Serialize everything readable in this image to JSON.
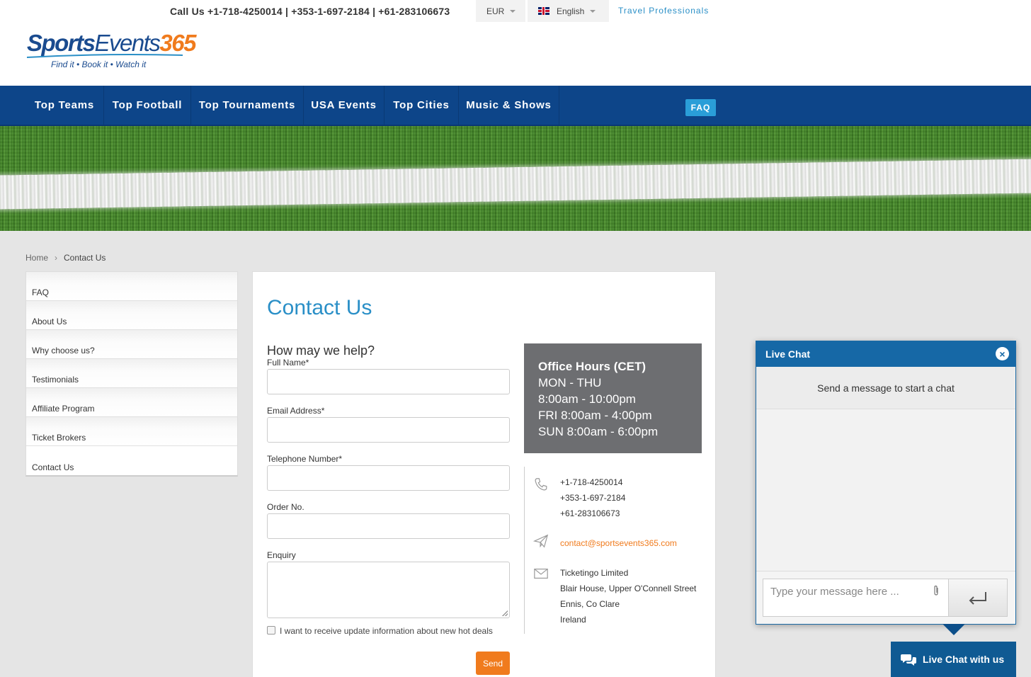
{
  "header": {
    "call_us": "Call Us +1-718-4250014 | +353-1-697-2184 | +61-283106673",
    "currency": "EUR",
    "language": "English",
    "travel_professionals": "Travel Professionals",
    "logo": {
      "brand_part1": "Sports",
      "brand_part2": "Events",
      "brand_part3": "365",
      "tagline": "Find it • Book it • Watch it"
    }
  },
  "nav": {
    "items": [
      {
        "label": "Top Teams"
      },
      {
        "label": "Top Football"
      },
      {
        "label": "Top Tournaments"
      },
      {
        "label": "USA Events"
      },
      {
        "label": "Top Cities"
      },
      {
        "label": "Music & Shows"
      }
    ],
    "faq": "FAQ"
  },
  "breadcrumb": {
    "home": "Home",
    "separator": "›",
    "current": "Contact Us"
  },
  "sidebar": {
    "items": [
      {
        "label": "FAQ"
      },
      {
        "label": "About Us"
      },
      {
        "label": "Why choose us?"
      },
      {
        "label": "Testimonials"
      },
      {
        "label": "Affiliate Program"
      },
      {
        "label": "Ticket Brokers"
      },
      {
        "label": "Contact Us"
      }
    ]
  },
  "main": {
    "title": "Contact Us",
    "help_title": "How may we help?",
    "form": {
      "full_name_label": "Full Name*",
      "email_label": "Email Address*",
      "telephone_label": "Telephone Number*",
      "order_label": "Order No.",
      "enquiry_label": "Enquiry",
      "checkbox_label": "I want to receive update information about new hot deals",
      "send_label": "Send"
    },
    "office_hours": {
      "title": "Office Hours (CET)",
      "lines": [
        "MON - THU",
        "8:00am - 10:00pm",
        "FRI 8:00am - 4:00pm",
        "SUN 8:00am - 6:00pm"
      ]
    },
    "contact": {
      "phones": [
        "+1-718-4250014",
        "+353-1-697-2184",
        "+61-283106673"
      ],
      "email": "contact@sportsevents365.com",
      "address": [
        "Ticketingo Limited",
        "Blair House, Upper O'Connell Street",
        "Ennis, Co Clare",
        "Ireland"
      ]
    }
  },
  "chat": {
    "title": "Live Chat",
    "close": "×",
    "status": "Send a message to start a chat",
    "placeholder": "Type your message here ...",
    "tab_label": "Live Chat with us"
  },
  "colors": {
    "nav_bg": "#0d4589",
    "accent_blue": "#2a8fc7",
    "accent_orange": "#f07b1d",
    "office_hours_bg": "#6d6e71",
    "chat_header": "#1668a6"
  }
}
